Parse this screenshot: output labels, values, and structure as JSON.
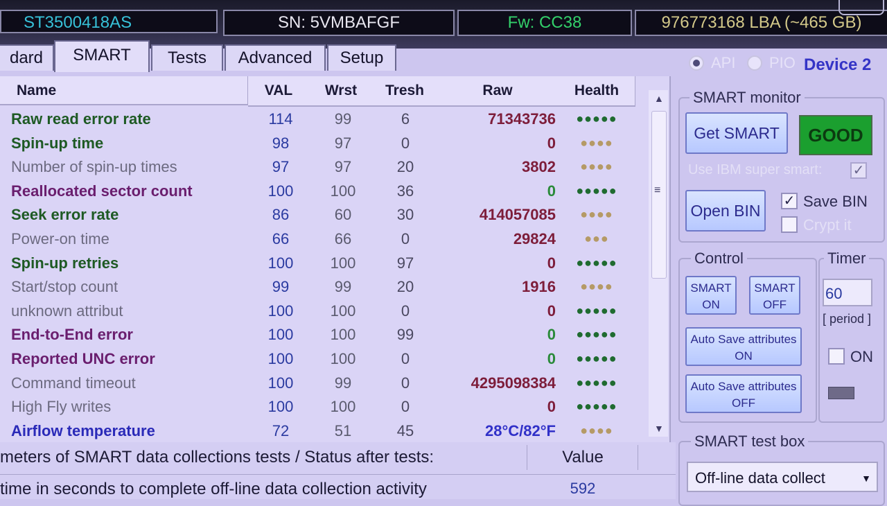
{
  "header": {
    "model": "ST3500418AS",
    "serial": "SN: 5VMBAFGF",
    "firmware": "Fw: CC38",
    "capacity": "976773168 LBA (~465 GB)"
  },
  "tabs": [
    {
      "label": "dard"
    },
    {
      "label": "SMART",
      "active": true
    },
    {
      "label": "Tests"
    },
    {
      "label": "Advanced"
    },
    {
      "label": "Setup"
    }
  ],
  "mode": {
    "api_label": "API",
    "pio_label": "PIO",
    "device_label": "Device 2",
    "selected": "API"
  },
  "table": {
    "columns": [
      "Name",
      "VAL",
      "Wrst",
      "Tresh",
      "Raw",
      "Health"
    ],
    "rows": [
      {
        "name": "Raw read error rate",
        "val": "114",
        "wrst": "99",
        "tresh": "6",
        "raw": "71343736",
        "health": "●●●●●",
        "name_color": "#1e5a24",
        "raw_color": "#7d1d3a",
        "health_color": "#1f6b30",
        "bold": true
      },
      {
        "name": "Spin-up time",
        "val": "98",
        "wrst": "97",
        "tresh": "0",
        "raw": "0",
        "health": "●●●●",
        "name_color": "#1e5a24",
        "raw_color": "#7d1d3a",
        "health_color": "#b59a66",
        "bold": true
      },
      {
        "name": "Number of spin-up times",
        "val": "97",
        "wrst": "97",
        "tresh": "20",
        "raw": "3802",
        "health": "●●●●",
        "name_color": "#6c6a80",
        "raw_color": "#7d1d3a",
        "health_color": "#b59a66",
        "bold": false
      },
      {
        "name": "Reallocated sector count",
        "val": "100",
        "wrst": "100",
        "tresh": "36",
        "raw": "0",
        "health": "●●●●●",
        "name_color": "#6a1e6e",
        "raw_color": "#2a8a3a",
        "health_color": "#1f6b30",
        "bold": true
      },
      {
        "name": "Seek error rate",
        "val": "86",
        "wrst": "60",
        "tresh": "30",
        "raw": "414057085",
        "health": "●●●●",
        "name_color": "#1e5a24",
        "raw_color": "#7d1d3a",
        "health_color": "#b59a66",
        "bold": true
      },
      {
        "name": "Power-on time",
        "val": "66",
        "wrst": "66",
        "tresh": "0",
        "raw": "29824",
        "health": "●●●",
        "name_color": "#6c6a80",
        "raw_color": "#7d1d3a",
        "health_color": "#b59a66",
        "bold": false
      },
      {
        "name": "Spin-up retries",
        "val": "100",
        "wrst": "100",
        "tresh": "97",
        "raw": "0",
        "health": "●●●●●",
        "name_color": "#1e5a24",
        "raw_color": "#7d1d3a",
        "health_color": "#1f6b30",
        "bold": true
      },
      {
        "name": "Start/stop count",
        "val": "99",
        "wrst": "99",
        "tresh": "20",
        "raw": "1916",
        "health": "●●●●",
        "name_color": "#6c6a80",
        "raw_color": "#7d1d3a",
        "health_color": "#b59a66",
        "bold": false
      },
      {
        "name": "unknown attribut",
        "val": "100",
        "wrst": "100",
        "tresh": "0",
        "raw": "0",
        "health": "●●●●●",
        "name_color": "#6c6a80",
        "raw_color": "#7d1d3a",
        "health_color": "#1f6b30",
        "bold": false
      },
      {
        "name": "End-to-End error",
        "val": "100",
        "wrst": "100",
        "tresh": "99",
        "raw": "0",
        "health": "●●●●●",
        "name_color": "#6a1e6e",
        "raw_color": "#2a8a3a",
        "health_color": "#1f6b30",
        "bold": true
      },
      {
        "name": "Reported UNC error",
        "val": "100",
        "wrst": "100",
        "tresh": "0",
        "raw": "0",
        "health": "●●●●●",
        "name_color": "#6a1e6e",
        "raw_color": "#2a8a3a",
        "health_color": "#1f6b30",
        "bold": true
      },
      {
        "name": "Command timeout",
        "val": "100",
        "wrst": "99",
        "tresh": "0",
        "raw": "4295098384",
        "health": "●●●●●",
        "name_color": "#6c6a80",
        "raw_color": "#7d1d3a",
        "health_color": "#1f6b30",
        "bold": false
      },
      {
        "name": "High Fly writes",
        "val": "100",
        "wrst": "100",
        "tresh": "0",
        "raw": "0",
        "health": "●●●●●",
        "name_color": "#6c6a80",
        "raw_color": "#7d1d3a",
        "health_color": "#1f6b30",
        "bold": false
      },
      {
        "name": "Airflow temperature",
        "val": "72",
        "wrst": "51",
        "tresh": "45",
        "raw": "28°C/82°F",
        "health": "●●●●",
        "name_color": "#2a2ab8",
        "raw_color": "#3030c8",
        "health_color": "#b59a66",
        "bold": true
      }
    ]
  },
  "bottom": {
    "header_left": "meters of SMART data collections tests / Status after tests:",
    "header_value": "Value",
    "row_text": "time in seconds to complete off-line data collection activity",
    "row_value": "592"
  },
  "smart_monitor": {
    "title": "SMART monitor",
    "get_smart": "Get SMART",
    "status": "GOOD",
    "ibm_label": "Use IBM super smart:",
    "ibm_checked": true,
    "open_bin": "Open BIN",
    "save_bin": "Save BIN",
    "save_bin_checked": true,
    "crypt": "Crypt it",
    "crypt_checked": false
  },
  "control": {
    "title": "Control",
    "smart_on": "SMART ON",
    "smart_off": "SMART OFF",
    "auto_on": "Auto Save attributes ON",
    "auto_off": "Auto Save attributes OFF"
  },
  "timer": {
    "title": "Timer",
    "value": "60",
    "period": "[ period ]",
    "on_label": "ON",
    "on_checked": false
  },
  "test_box": {
    "title": "SMART test box",
    "selected": "Off-line data collect"
  },
  "colors": {
    "accent": "#2b2a8d",
    "good": "#1b9f2f",
    "grid_bg": "#dad4f6"
  }
}
